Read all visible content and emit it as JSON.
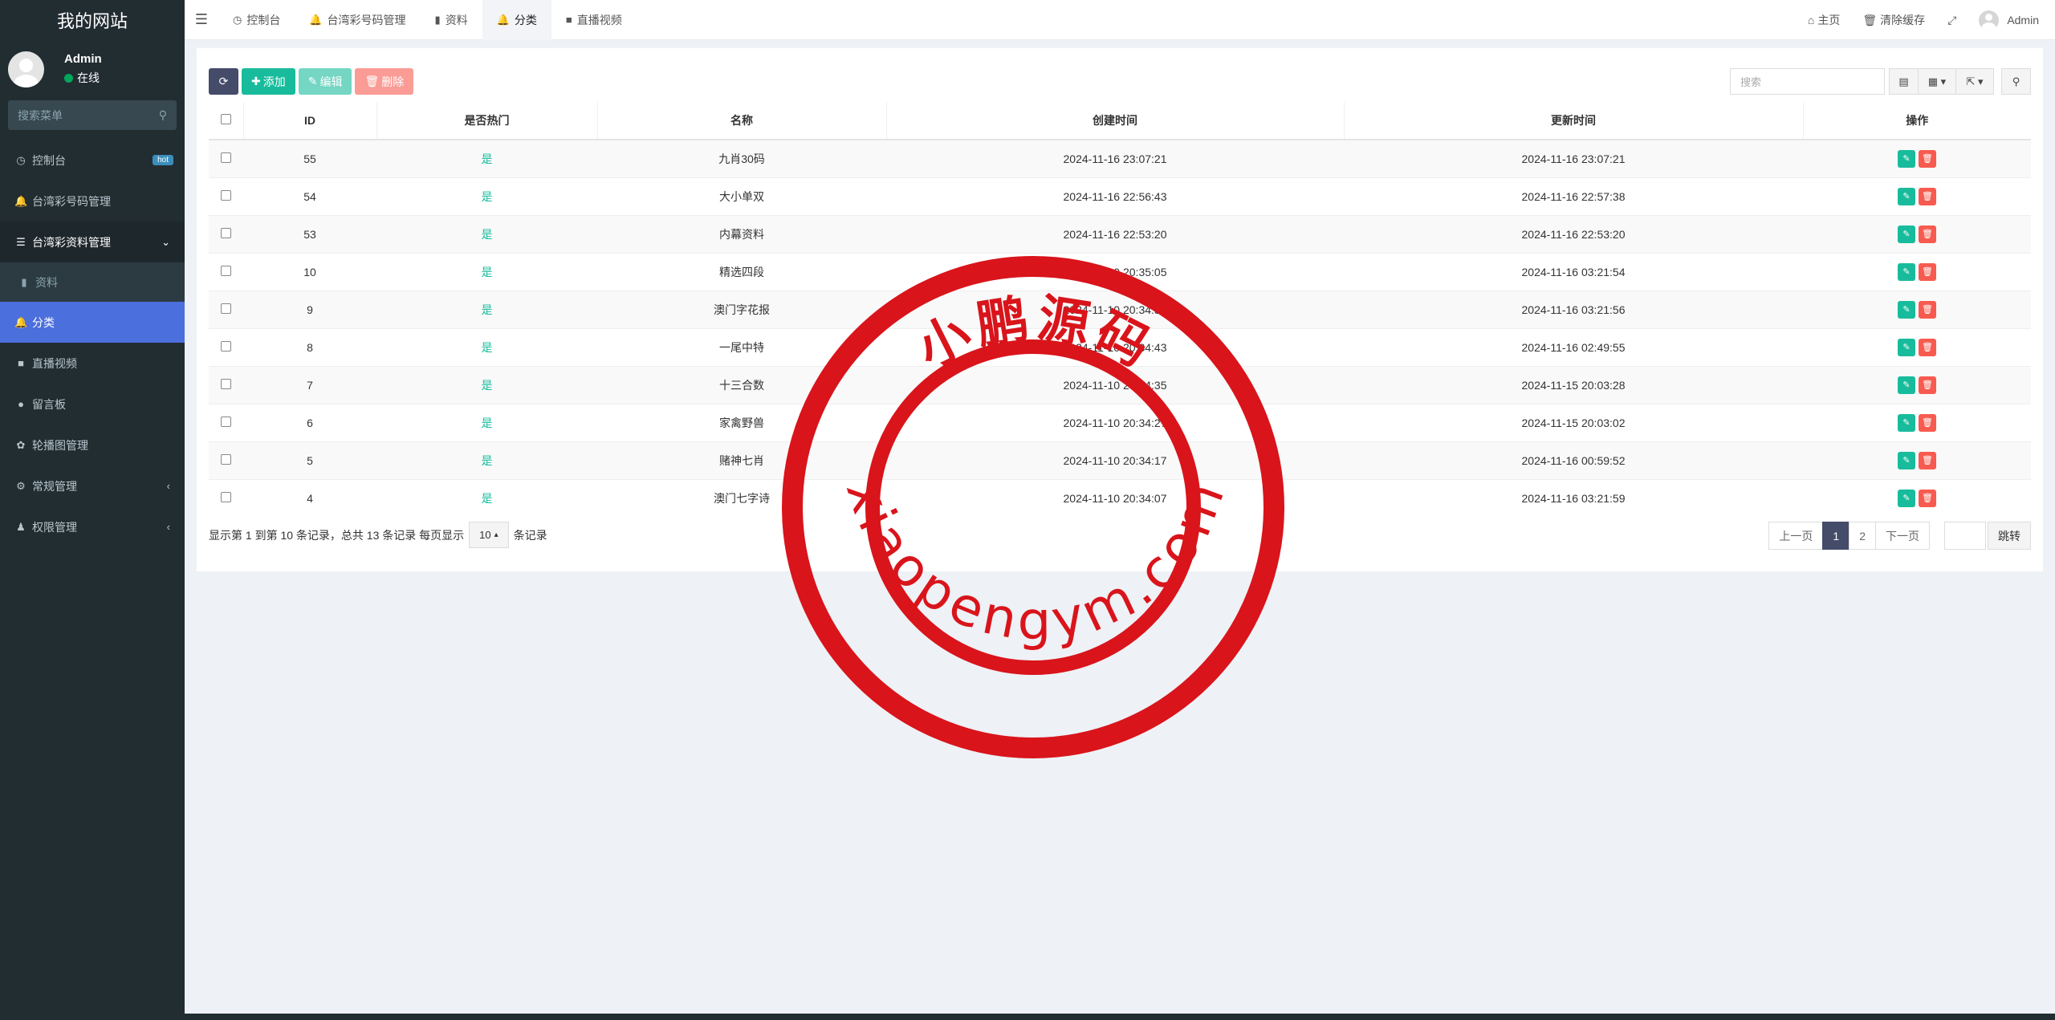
{
  "sidebar": {
    "brand": "我的网站",
    "user": {
      "name": "Admin",
      "status": "在线"
    },
    "search_placeholder": "搜索菜单",
    "items": [
      {
        "label": "控制台",
        "badge": "hot",
        "icon": "dashboard-icon"
      },
      {
        "label": "台湾彩号码管理",
        "icon": "bell-icon"
      },
      {
        "label": "台湾彩资料管理",
        "icon": "list-icon",
        "open": true
      },
      {
        "label": "资料",
        "icon": "bookmark-icon",
        "sub": true
      },
      {
        "label": "分类",
        "icon": "bell-icon",
        "active": true
      },
      {
        "label": "直播视频",
        "icon": "video-icon"
      },
      {
        "label": "留言板",
        "icon": "comment-icon"
      },
      {
        "label": "轮播图管理",
        "icon": "leaf-icon"
      },
      {
        "label": "常规管理",
        "icon": "cogs-icon"
      },
      {
        "label": "权限管理",
        "icon": "group-icon"
      }
    ]
  },
  "topbar": {
    "tabs": [
      {
        "label": "控制台",
        "icon": "dashboard-icon"
      },
      {
        "label": "台湾彩号码管理",
        "icon": "bell-icon"
      },
      {
        "label": "资料",
        "icon": "bookmark-icon"
      },
      {
        "label": "分类",
        "icon": "bell-icon",
        "active": true
      },
      {
        "label": "直播视频",
        "icon": "video-icon"
      }
    ],
    "home": "主页",
    "clear_cache": "清除缓存",
    "admin": "Admin"
  },
  "toolbar": {
    "add": "添加",
    "edit": "编辑",
    "delete": "删除",
    "search_placeholder": "搜索"
  },
  "table": {
    "columns": [
      "ID",
      "是否热门",
      "名称",
      "创建时间",
      "更新时间",
      "操作"
    ],
    "rows": [
      {
        "id": "55",
        "hot": "是",
        "name": "九肖30码",
        "created": "2024-11-16 23:07:21",
        "updated": "2024-11-16 23:07:21"
      },
      {
        "id": "54",
        "hot": "是",
        "name": "大小单双",
        "created": "2024-11-16 22:56:43",
        "updated": "2024-11-16 22:57:38"
      },
      {
        "id": "53",
        "hot": "是",
        "name": "内幕资料",
        "created": "2024-11-16 22:53:20",
        "updated": "2024-11-16 22:53:20"
      },
      {
        "id": "10",
        "hot": "是",
        "name": "精选四段",
        "created": "2024-11-10 20:35:05",
        "updated": "2024-11-16 03:21:54"
      },
      {
        "id": "9",
        "hot": "是",
        "name": "澳门字花报",
        "created": "2024-11-10 20:34:51",
        "updated": "2024-11-16 03:21:56"
      },
      {
        "id": "8",
        "hot": "是",
        "name": "一尾中特",
        "created": "2024-11-10 20:34:43",
        "updated": "2024-11-16 02:49:55"
      },
      {
        "id": "7",
        "hot": "是",
        "name": "十三合数",
        "created": "2024-11-10 20:34:35",
        "updated": "2024-11-15 20:03:28"
      },
      {
        "id": "6",
        "hot": "是",
        "name": "家禽野兽",
        "created": "2024-11-10 20:34:27",
        "updated": "2024-11-15 20:03:02"
      },
      {
        "id": "5",
        "hot": "是",
        "name": "赌神七肖",
        "created": "2024-11-10 20:34:17",
        "updated": "2024-11-16 00:59:52"
      },
      {
        "id": "4",
        "hot": "是",
        "name": "澳门七字诗",
        "created": "2024-11-10 20:34:07",
        "updated": "2024-11-16 03:21:59"
      }
    ]
  },
  "footer": {
    "summary": "显示第 1 到第 10 条记录，总共 13 条记录 每页显示",
    "page_size": "10",
    "suffix": "条记录",
    "prev": "上一页",
    "pages": [
      "1",
      "2"
    ],
    "next": "下一页",
    "jump": "跳转"
  },
  "watermark": {
    "top_text": "小鹏源码",
    "bottom_text": "xiaopengym.com",
    "color": "#d9141b"
  }
}
